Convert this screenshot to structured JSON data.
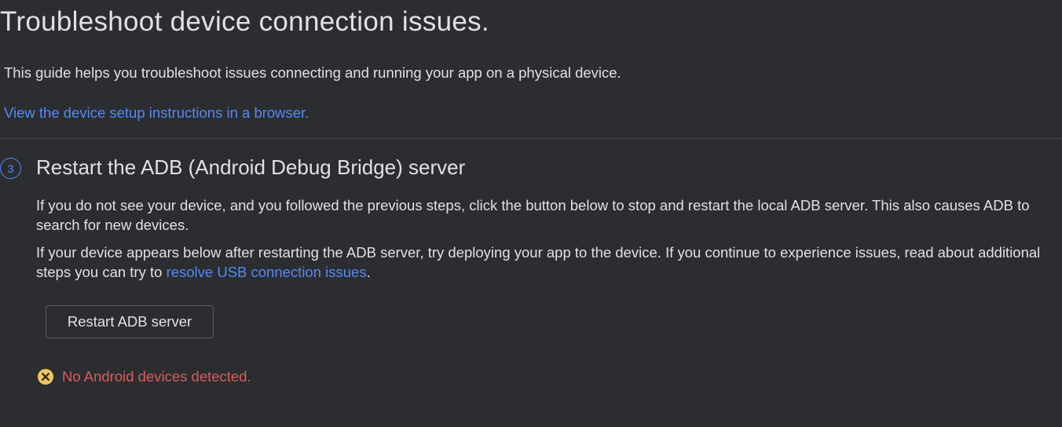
{
  "header": {
    "title": "Troubleshoot device connection issues.",
    "intro": "This guide helps you troubleshoot issues connecting and running your app on a physical device.",
    "setup_link": "View the device setup instructions in a browser."
  },
  "step": {
    "number": "3",
    "title": "Restart the ADB (Android Debug Bridge) server",
    "paragraph1": "If you do not see your device, and you followed the previous steps, click the button below to stop and restart the local ADB server. This also causes ADB to search for new devices.",
    "paragraph2_prefix": "If your device appears below after restarting the ADB server, try deploying your app to the device. If you continue to experience issues, read about additional steps you can try to ",
    "paragraph2_link": "resolve USB connection issues",
    "paragraph2_suffix": ".",
    "button_label": "Restart ADB server"
  },
  "status": {
    "icon": "error-circle-icon",
    "text": "No Android devices detected.",
    "icon_color": "#f2c55c",
    "text_color": "#db5c5c"
  },
  "colors": {
    "background": "#2b2d30",
    "text": "#dfe1e5",
    "link": "#548af7",
    "divider": "#43454a"
  }
}
